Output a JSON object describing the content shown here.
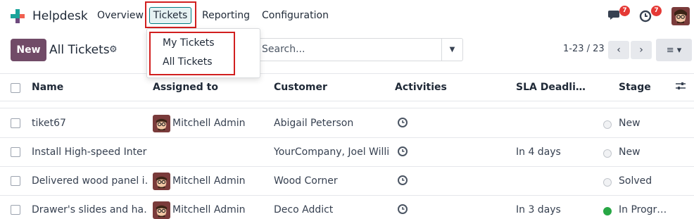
{
  "app": {
    "name": "Helpdesk"
  },
  "nav": {
    "items": [
      {
        "label": "Overview"
      },
      {
        "label": "Tickets"
      },
      {
        "label": "Reporting"
      },
      {
        "label": "Configuration"
      }
    ],
    "messages_badge": "7",
    "activities_badge": "7"
  },
  "tickets_menu": {
    "items": [
      {
        "label": "My Tickets"
      },
      {
        "label": "All Tickets"
      }
    ]
  },
  "control_panel": {
    "new_label": "New",
    "title": "All Tickets",
    "search_placeholder": "Search...",
    "pager": "1-23 / 23"
  },
  "table": {
    "columns": [
      "Name",
      "Assigned to",
      "Customer",
      "Activities",
      "SLA Deadli…",
      "Stage"
    ],
    "rows": [
      {
        "name": "tiket67",
        "assigned": "Mitchell Admin",
        "customer": "Abigail Peterson",
        "sla": "",
        "stage": "New",
        "stage_color": "grey"
      },
      {
        "name": "Install High-speed Inter…",
        "assigned": "",
        "customer": "YourCompany, Joel Willis",
        "sla": "In 4 days",
        "stage": "New",
        "stage_color": "grey"
      },
      {
        "name": "Delivered wood panel i…",
        "assigned": "Mitchell Admin",
        "customer": "Wood Corner",
        "sla": "",
        "stage": "Solved",
        "stage_color": "grey"
      },
      {
        "name": "Drawer's slides and ha…",
        "assigned": "Mitchell Admin",
        "customer": "Deco Addict",
        "sla": "In 3 days",
        "stage": "In Progr…",
        "stage_color": "green"
      }
    ]
  },
  "colors": {
    "brand": "#714b67",
    "accent": "#017e84",
    "highlight": "#d11f1f",
    "badge": "#e53935"
  },
  "icons": [
    "helpdesk-logo-icon",
    "chat-icon",
    "clock-icon",
    "gear-icon",
    "caret-down-icon",
    "chevron-left-icon",
    "chevron-right-icon",
    "list-view-icon",
    "column-settings-icon"
  ]
}
